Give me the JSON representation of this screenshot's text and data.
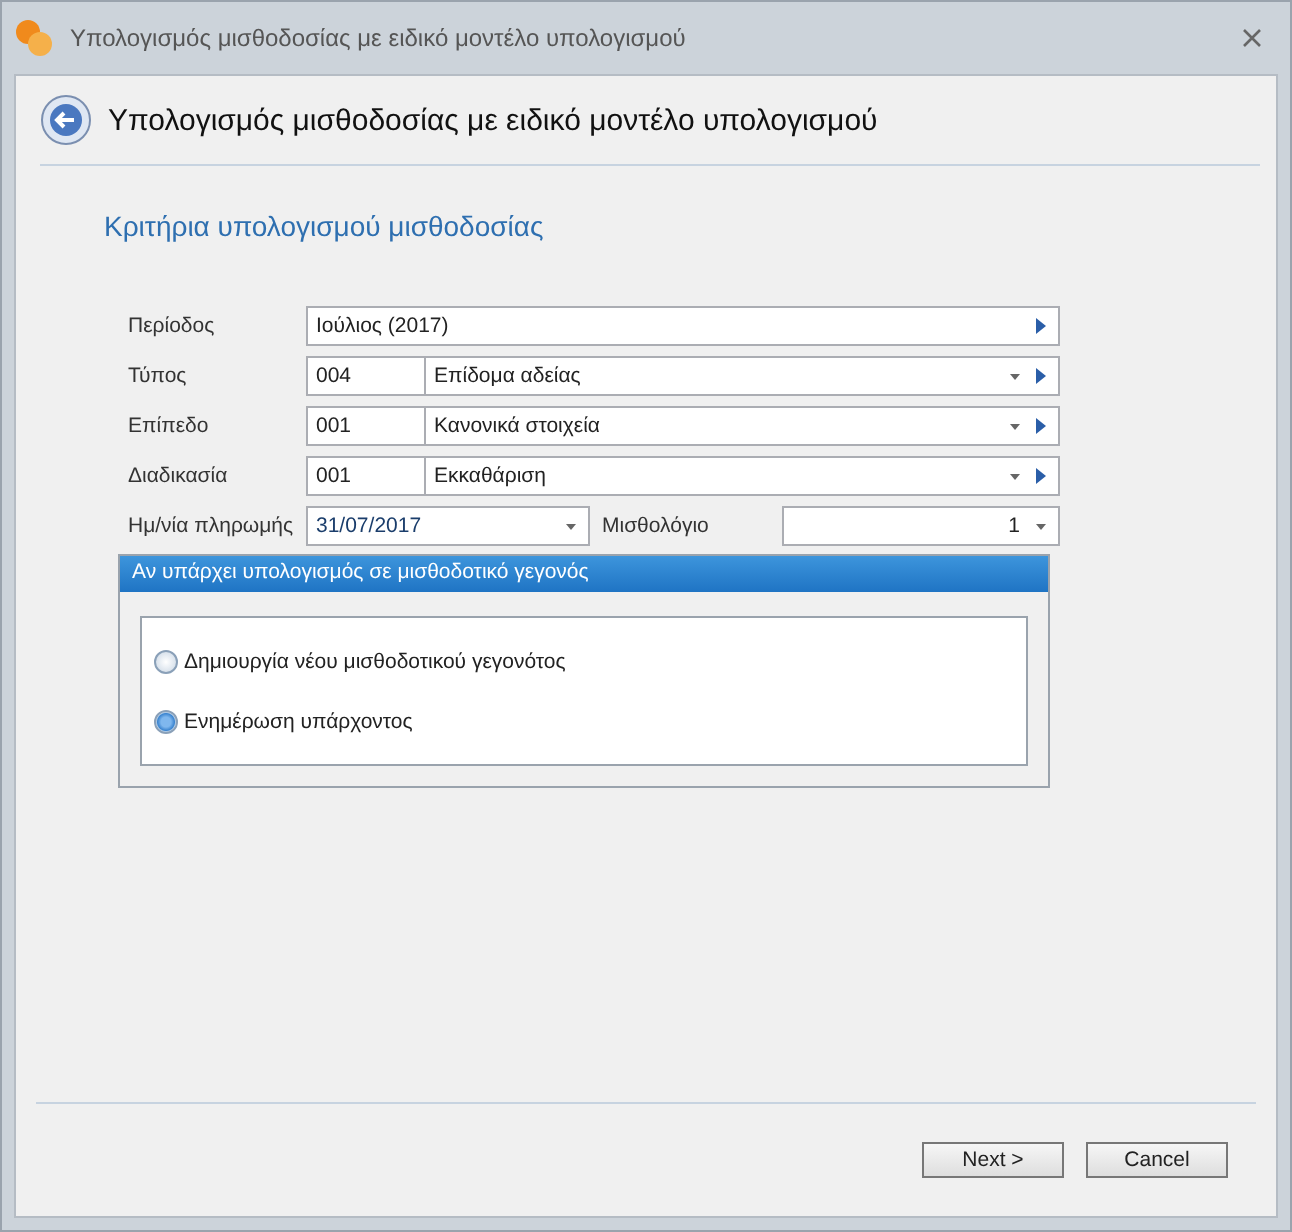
{
  "window": {
    "title": "Υπολογισμός μισθοδοσίας με ειδικό μοντέλο υπολογισμού"
  },
  "header": {
    "title": "Υπολογισμός μισθοδοσίας με ειδικό μοντέλο υπολογισμού"
  },
  "section_title": "Κριτήρια υπολογισμού μισθοδοσίας",
  "fields": [
    {
      "kind": "lookup",
      "label": "Περίοδος",
      "value": "Ιούλιος (2017)"
    },
    {
      "kind": "coded",
      "label": "Τύπος",
      "code": "004",
      "value": "Επίδομα αδείας"
    },
    {
      "kind": "coded",
      "label": "Επίπεδο",
      "code": "001",
      "value": "Κανονικά στοιχεία"
    },
    {
      "kind": "coded",
      "label": "Διαδικασία",
      "code": "001",
      "value": "Εκκαθάριση"
    }
  ],
  "payment": {
    "label": "Ημ/νία πληρωμής",
    "value": "31/07/2017",
    "payroll_label": "Μισθολόγιο",
    "payroll_value": "1"
  },
  "group": {
    "title": "Αν υπάρχει υπολογισμός σε μισθοδοτικό γεγονός",
    "options": [
      {
        "label": "Δημιουργία νέου μισθοδοτικού γεγονότος",
        "selected": false
      },
      {
        "label": "Ενημέρωση υπάρχοντος",
        "selected": true
      }
    ]
  },
  "buttons": [
    "Next >",
    "Cancel"
  ]
}
